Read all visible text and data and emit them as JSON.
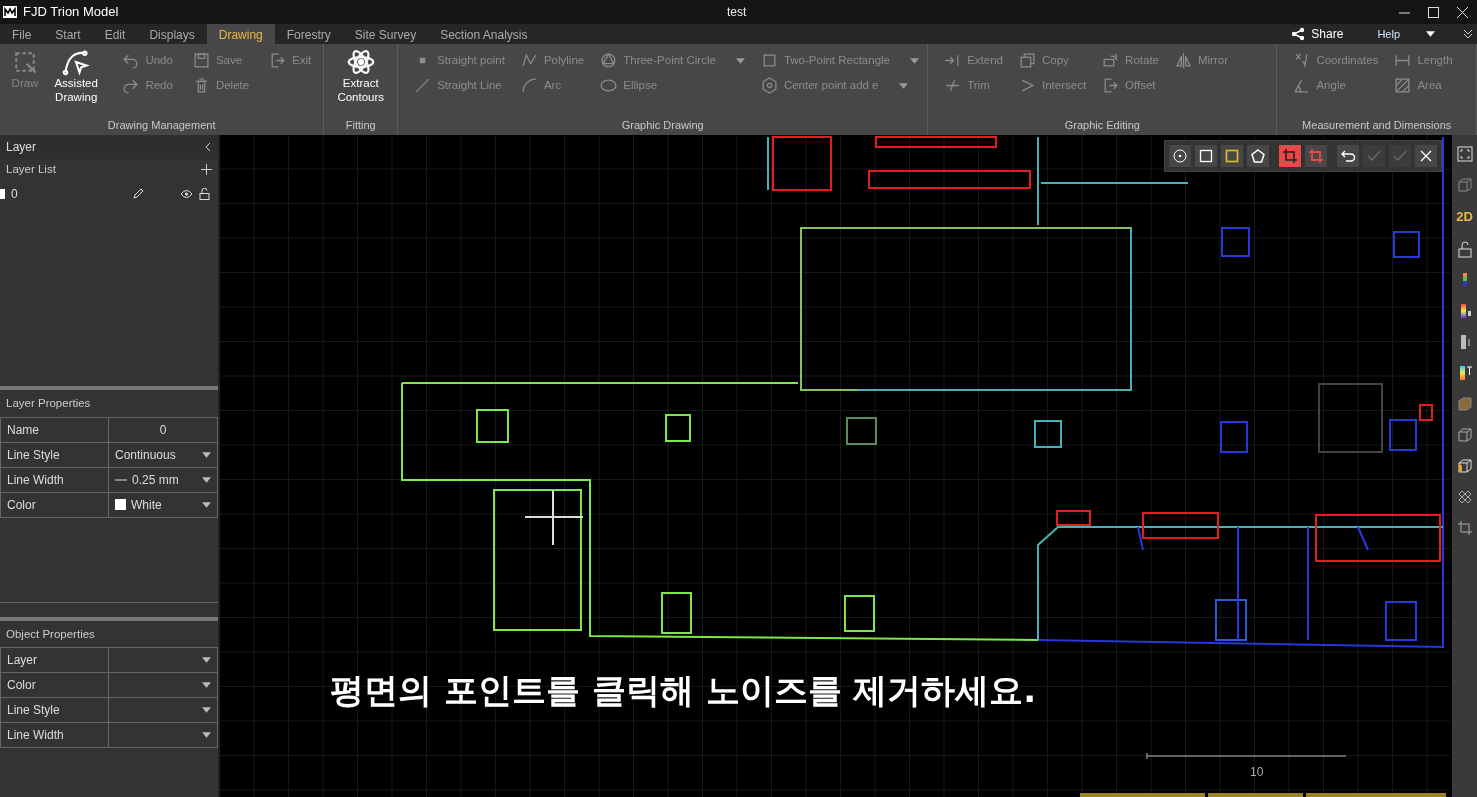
{
  "window": {
    "app_title": "FJD Trion Model",
    "document_title": "test"
  },
  "menu_tabs": [
    {
      "label": "File",
      "selected": false
    },
    {
      "label": "Start",
      "selected": false
    },
    {
      "label": "Edit",
      "selected": false
    },
    {
      "label": "Displays",
      "selected": false
    },
    {
      "label": "Drawing",
      "selected": true
    },
    {
      "label": "Forestry",
      "selected": false
    },
    {
      "label": "Site Survey",
      "selected": false
    },
    {
      "label": "Section Analysis",
      "selected": false
    }
  ],
  "header_actions": {
    "share": "Share",
    "help": "Help"
  },
  "ribbon": [
    {
      "label": "Drawing Management",
      "large_tools": [
        {
          "label": "Draw",
          "disabled": true
        },
        {
          "label": "Assisted Drawing",
          "disabled": false
        }
      ],
      "columns": [
        [
          {
            "label": "Undo",
            "disabled": true,
            "dropdown": false
          },
          {
            "label": "Redo",
            "disabled": true,
            "dropdown": false
          }
        ],
        [
          {
            "label": "Save",
            "disabled": true,
            "dropdown": false
          },
          {
            "label": "Delete",
            "disabled": true,
            "dropdown": false
          }
        ],
        [
          {
            "label": "Exit",
            "disabled": true,
            "dropdown": false
          }
        ]
      ]
    },
    {
      "label": "Fitting",
      "large_tools": [
        {
          "label": "Extract Contours",
          "disabled": false
        }
      ]
    },
    {
      "label": "Graphic Drawing",
      "columns": [
        [
          {
            "label": "Straight point",
            "disabled": true,
            "dropdown": false
          },
          {
            "label": "Straight Line",
            "disabled": true,
            "dropdown": false
          }
        ],
        [
          {
            "label": "Polyline",
            "disabled": true,
            "dropdown": false
          },
          {
            "label": "Arc",
            "disabled": true,
            "dropdown": false
          }
        ],
        [
          {
            "label": "Three-Point Circle",
            "disabled": true,
            "dropdown": true
          },
          {
            "label": "Ellipse",
            "disabled": true,
            "dropdown": false
          }
        ],
        [
          {
            "label": "Two-Point Rectangle",
            "disabled": true,
            "dropdown": true
          },
          {
            "label": "Center point add e",
            "disabled": true,
            "dropdown": true
          }
        ]
      ]
    },
    {
      "label": "Graphic Editing",
      "columns": [
        [
          {
            "label": "Extend",
            "disabled": true,
            "dropdown": false
          },
          {
            "label": "Trim",
            "disabled": true,
            "dropdown": false
          }
        ],
        [
          {
            "label": "Copy",
            "disabled": true,
            "dropdown": false
          },
          {
            "label": "Intersect",
            "disabled": true,
            "dropdown": false
          }
        ],
        [
          {
            "label": "Rotate",
            "disabled": true,
            "dropdown": false
          },
          {
            "label": "Offset",
            "disabled": true,
            "dropdown": false
          }
        ],
        [
          {
            "label": "Mirror",
            "disabled": true,
            "dropdown": false
          }
        ]
      ]
    },
    {
      "label": "Measurement and Dimensions",
      "columns": [
        [
          {
            "label": "Coordinates",
            "disabled": true,
            "dropdown": false
          },
          {
            "label": "Angle",
            "disabled": true,
            "dropdown": false
          }
        ],
        [
          {
            "label": "Length",
            "disabled": true,
            "dropdown": false
          },
          {
            "label": "Area",
            "disabled": true,
            "dropdown": false
          }
        ]
      ]
    }
  ],
  "layer_panel": {
    "title": "Layer",
    "list_title": "Layer List",
    "layers": [
      {
        "name": "0",
        "color": "#ffffff",
        "visible": true,
        "locked": false
      }
    ],
    "layer_properties": {
      "title": "Layer Properties",
      "rows": [
        {
          "label": "Name",
          "value": "0",
          "kind": "text"
        },
        {
          "label": "Line Style",
          "value": "Continuous",
          "kind": "select"
        },
        {
          "label": "Line Width",
          "value": "0.25 mm",
          "kind": "linewidth"
        },
        {
          "label": "Color",
          "value": "White",
          "kind": "color",
          "color": "#ffffff"
        }
      ]
    },
    "object_properties": {
      "title": "Object Properties",
      "rows": [
        {
          "label": "Layer",
          "kind": "select"
        },
        {
          "label": "Color",
          "kind": "select"
        },
        {
          "label": "Line Style",
          "kind": "select"
        },
        {
          "label": "Line Width",
          "kind": "select"
        }
      ]
    }
  },
  "canvas": {
    "toolbar": [
      {
        "selected": false,
        "disabled": false
      },
      {
        "selected": false,
        "disabled": false
      },
      {
        "selected": false,
        "disabled": false
      },
      {
        "selected": false,
        "disabled": false
      },
      {
        "selected": true,
        "disabled": false
      },
      {
        "selected": false,
        "disabled": false
      },
      {
        "selected": false,
        "disabled": false
      },
      {
        "selected": false,
        "disabled": true
      },
      {
        "selected": false,
        "disabled": true
      },
      {
        "selected": false,
        "disabled": false
      }
    ],
    "scale_label": "10",
    "caption": "평면의 포인트를 클릭해 노이즈를 제거하세요."
  },
  "view_toolbar": {
    "mode_label": "2D"
  }
}
